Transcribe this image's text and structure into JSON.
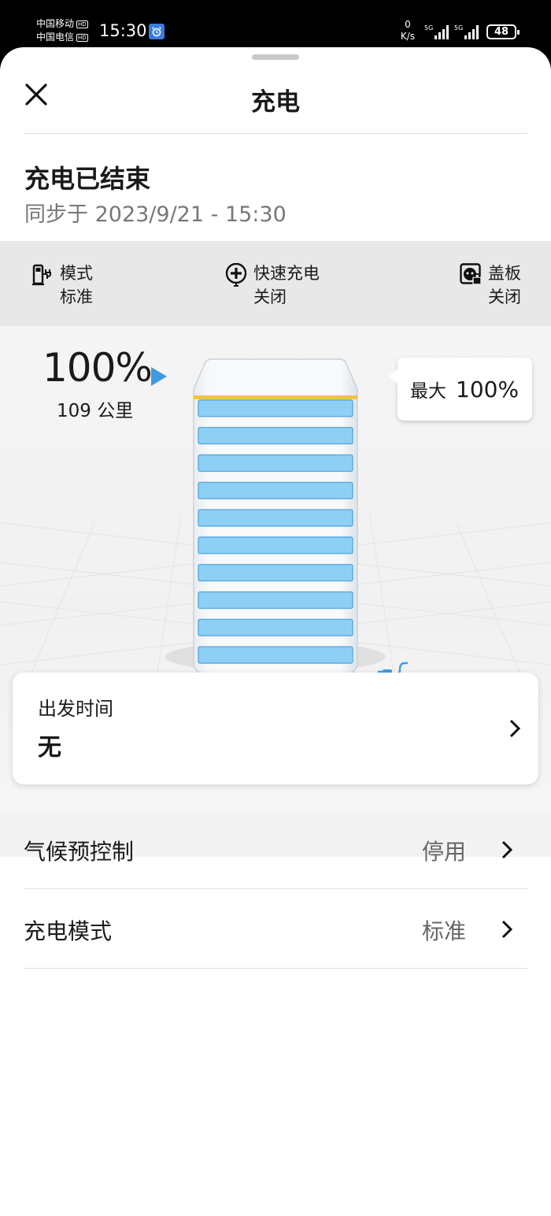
{
  "status_bar": {
    "carrier_1": "中国移动",
    "carrier_2": "中国电信",
    "hd_label": "HD",
    "time": "15:30",
    "net_speed_value": "0",
    "net_speed_unit": "K/s",
    "signal_1_label": "5G",
    "signal_2_label": "5G",
    "battery_level": "48"
  },
  "header": {
    "title": "充电",
    "close_icon": "close-icon"
  },
  "charge_status": {
    "title": "充电已结束",
    "sync_prefix": "同步于",
    "sync_time": "2023/9/21 - 15:30"
  },
  "info_bar": {
    "mode": {
      "label": "模式",
      "value": "标准",
      "icon": "charger-plug-icon"
    },
    "fast_charge": {
      "label": "快速充电",
      "value": "关闭",
      "icon": "fast-charge-icon"
    },
    "flap": {
      "label": "盖板",
      "value": "关闭",
      "icon": "charging-flap-lock-icon"
    }
  },
  "battery": {
    "percent": "100%",
    "range": "109 公里",
    "charge_level": 1.0,
    "segments": 10,
    "max_label": "最大",
    "max_value": "100%",
    "fill_color": "#8ed0f5",
    "limit_color": "#f0c24a"
  },
  "departure": {
    "label": "出发时间",
    "value": "无"
  },
  "settings": [
    {
      "label": "气候预控制",
      "value": "停用"
    },
    {
      "label": "充电模式",
      "value": "标准"
    }
  ]
}
